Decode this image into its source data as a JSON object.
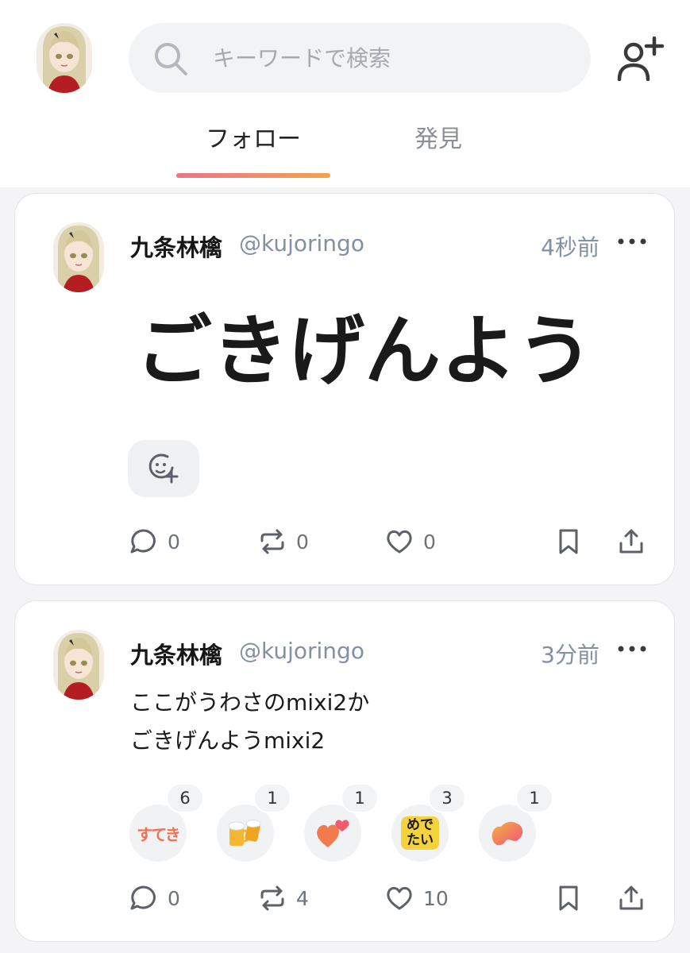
{
  "header": {
    "search_placeholder": "キーワードで検索",
    "tabs": [
      {
        "label": "フォロー",
        "active": true
      },
      {
        "label": "発見",
        "active": false
      }
    ],
    "accent_gradient": [
      "#f07289",
      "#f3a24e"
    ]
  },
  "posts": [
    {
      "author": "九条林檎",
      "handle": "@kujoringo",
      "time": "4秒前",
      "text": "ごきげんよう",
      "counts": {
        "replies": "0",
        "reposts": "0",
        "likes": "0"
      }
    },
    {
      "author": "九条林檎",
      "handle": "@kujoringo",
      "time": "3分前",
      "text": "ここがうわさのmixi2か\nごきげんようmixi2",
      "reactions": [
        {
          "icon": "sutekì-stamp",
          "label": "すてき",
          "count": "6"
        },
        {
          "icon": "beer-mugs-emoji",
          "label": "🍻",
          "count": "1"
        },
        {
          "icon": "two-hearts-emoji",
          "label": "",
          "count": "1"
        },
        {
          "icon": "medetai-stamp",
          "label": "めでたい",
          "count": "3"
        },
        {
          "icon": "heart-shape-emoji",
          "label": "",
          "count": "1"
        }
      ],
      "counts": {
        "replies": "0",
        "reposts": "4",
        "likes": "10"
      }
    }
  ]
}
